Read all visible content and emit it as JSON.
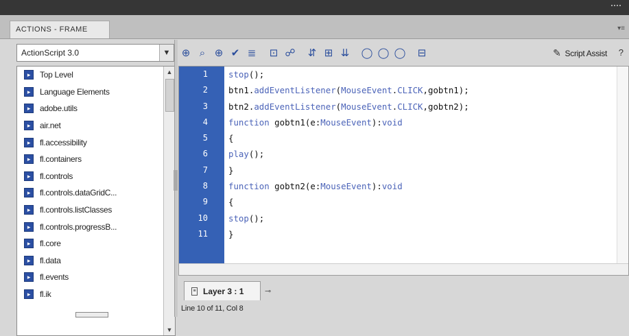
{
  "panel": {
    "tab_title": "ACTIONS - FRAME"
  },
  "language_select": {
    "value": "ActionScript 3.0"
  },
  "tree": {
    "items": [
      {
        "label": "Top Level"
      },
      {
        "label": "Language Elements"
      },
      {
        "label": "adobe.utils"
      },
      {
        "label": "air.net"
      },
      {
        "label": "fl.accessibility"
      },
      {
        "label": "fl.containers"
      },
      {
        "label": "fl.controls"
      },
      {
        "label": "fl.controls.dataGridC..."
      },
      {
        "label": "fl.controls.listClasses"
      },
      {
        "label": "fl.controls.progressB..."
      },
      {
        "label": "fl.core"
      },
      {
        "label": "fl.data"
      },
      {
        "label": "fl.events"
      },
      {
        "label": "fl.ik"
      }
    ]
  },
  "toolbar": {
    "icons": [
      "add-statement-icon",
      "find-icon",
      "insert-target-path-icon",
      "check-syntax-icon",
      "auto-format-icon",
      "code-hint-icon",
      "debug-options-icon",
      "collapse-braces-icon",
      "collapse-selection-icon",
      "expand-all-icon",
      "apply-block-comment-icon",
      "apply-line-comment-icon",
      "remove-comment-icon",
      "show-hide-toolbox-icon"
    ],
    "script_assist_label": "Script Assist"
  },
  "editor": {
    "line_numbers": [
      "1",
      "2",
      "3",
      "4",
      "5",
      "6",
      "7",
      "8",
      "9",
      "10",
      "11"
    ],
    "lines": [
      "stop();",
      "btn1.addEventListener(MouseEvent.CLICK,gobtn1);",
      "btn2.addEventListener(MouseEvent.CLICK,gobtn2);",
      "function gobtn1(e:MouseEvent):void",
      "{",
      "play();",
      "}",
      "function gobtn2(e:MouseEvent):void",
      "{",
      "stop();",
      "}"
    ]
  },
  "layer_tab": {
    "label": "Layer 3 : 1"
  },
  "status": {
    "text": "Line 10 of 11, Col 8"
  },
  "colors": {
    "gutter": "#3561b5",
    "keyword": "#4b63b8",
    "topbar": "#363636"
  }
}
